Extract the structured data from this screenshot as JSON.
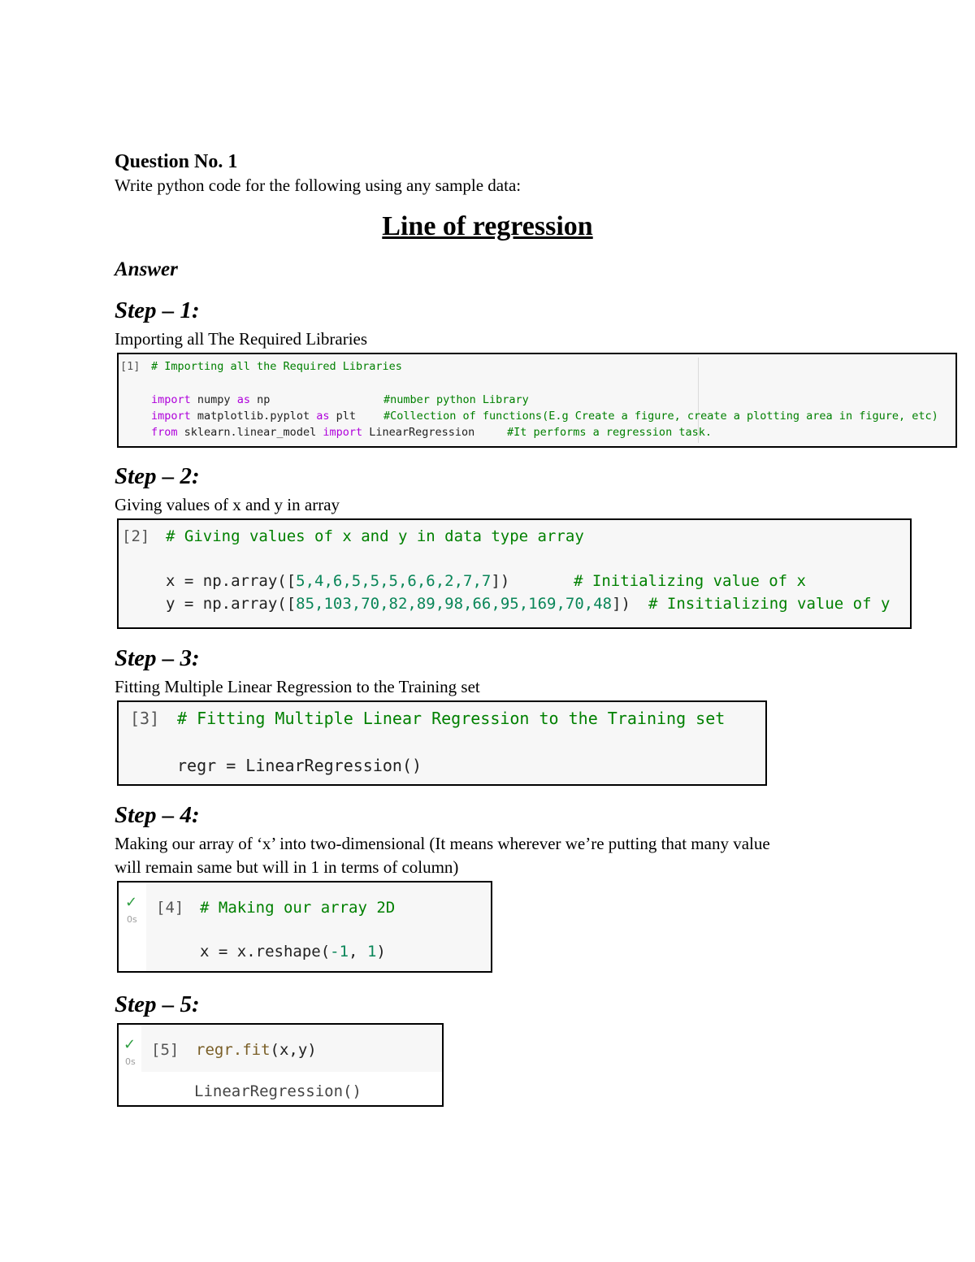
{
  "question": {
    "title": "Question No. 1",
    "prompt": "Write python code for the following using any sample data:",
    "heading": "Line of regression",
    "answer_label": "Answer"
  },
  "steps": [
    {
      "title": "Step – 1:",
      "description": "Importing all The Required Libraries",
      "cell": {
        "index": "[1]",
        "comment": "# Importing all the Required Libraries",
        "lines": [
          {
            "kw1": "import",
            "t1": " numpy ",
            "kw2": "as",
            "t2": " np",
            "comment": "#number python Library"
          },
          {
            "kw1": "import",
            "t1": " matplotlib.pyplot ",
            "kw2": "as",
            "t2": " plt",
            "comment": "#Collection of functions(E.g Create a figure, create a plotting area in figure, etc)"
          },
          {
            "kw1": "from",
            "t1": " sklearn.linear_model ",
            "kw2": "import",
            "t2": " LinearRegression",
            "comment": "#It performs a regression task."
          }
        ]
      }
    },
    {
      "title": "Step – 2:",
      "description": "Giving values of x and y in array",
      "cell": {
        "index": "[2]",
        "comment": "# Giving values of x and y in data type array",
        "x_prefix": "x = np.array([",
        "x_values": "5,4,6,5,5,5,6,6,2,7,7",
        "x_suffix": "])",
        "x_comment": "# Initializing value of x",
        "y_prefix": "y = np.array([",
        "y_values": "85,103,70,82,89,98,66,95,169,70,48",
        "y_suffix": "])",
        "y_comment": "# Insitializing value of y"
      }
    },
    {
      "title": "Step – 3:",
      "description": "Fitting Multiple Linear Regression to the Training set",
      "cell": {
        "index": "[3]",
        "comment": "# Fitting Multiple Linear Regression to the Training set",
        "code": "regr = LinearRegression()"
      }
    },
    {
      "title": "Step – 4:",
      "description_line1": "Making our array of ‘x’ into two-dimensional (It means wherever we’re putting that many value",
      "description_line2": "will remain same but will in 1 in terms of column)",
      "cell": {
        "status_icon": "check-icon",
        "runtime": "0s",
        "index": "[4]",
        "comment": "# Making our array 2D",
        "code_prefix": "x = x.reshape(",
        "arg1": "-1",
        "sep": ", ",
        "arg2": "1",
        "code_suffix": ")"
      }
    },
    {
      "title": "Step – 5:",
      "cell": {
        "status_icon": "check-icon",
        "runtime": "0s",
        "index": "[5]",
        "code_fn": "regr.fit",
        "code_args": "(x,y)",
        "output": "LinearRegression()"
      }
    }
  ]
}
